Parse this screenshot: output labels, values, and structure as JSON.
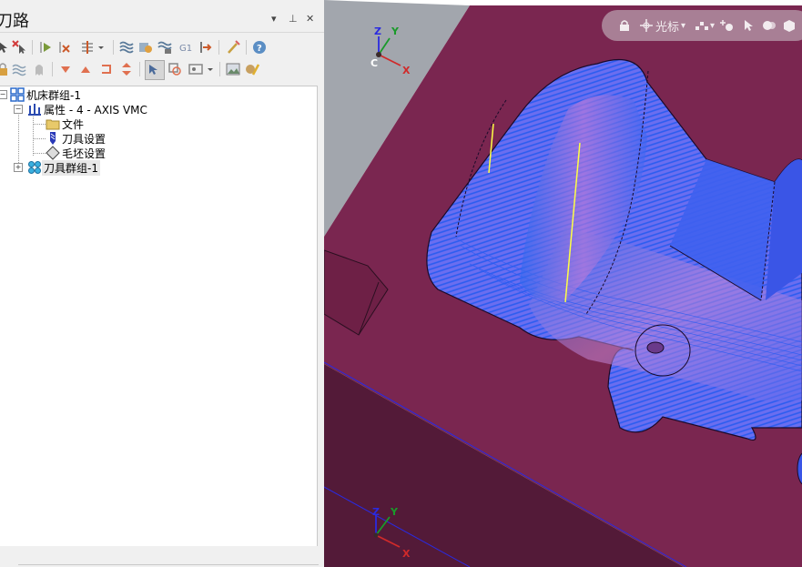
{
  "panel": {
    "title": "刀路",
    "dropdown_glyph": "▾",
    "pin_glyph": "⊥",
    "close_glyph": "✕"
  },
  "tree": {
    "machine_group": "机床群组-1",
    "properties": "属性 - 4 - AXIS VMC",
    "files": "文件",
    "tool_settings": "刀具设置",
    "stock_settings": "毛坯设置",
    "toolpath_group": "刀具群组-1"
  },
  "view_toolbar": {
    "lock_glyph": "🔒",
    "cursor_label": "光标",
    "dropdown_glyph": "▾"
  },
  "axes": {
    "z": "Z",
    "y": "Y",
    "x": "X",
    "c": "C"
  },
  "colors": {
    "part_top": "#7a2650",
    "part_side": "#531a38",
    "toolpath": "#1e6ff0",
    "lead_line": "#ffff44",
    "background_gray": "#a2a6ad"
  }
}
